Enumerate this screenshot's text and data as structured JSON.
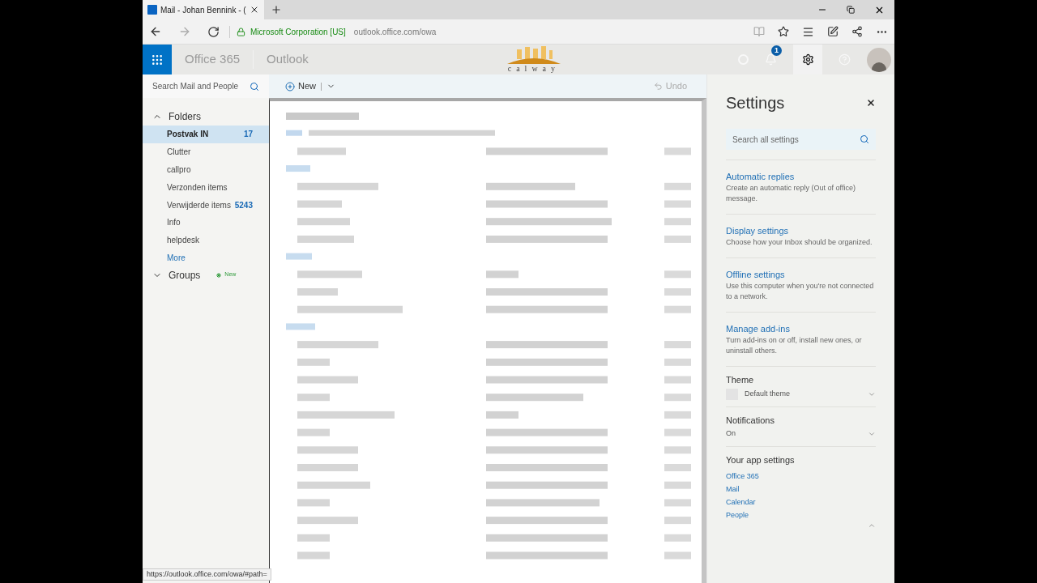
{
  "browser": {
    "tab_title": "Mail - Johan Bennink - (",
    "site_identity": "Microsoft Corporation [US]",
    "url": "outlook.office.com/owa",
    "status_url": "https://outlook.office.com/owa/#path="
  },
  "header": {
    "suite": "Office 365",
    "app": "Outlook",
    "logo": "calway",
    "notification_count": "1"
  },
  "search": {
    "placeholder": "Search Mail and People"
  },
  "folders": {
    "label": "Folders",
    "expanded": true,
    "items": [
      {
        "name": "Postvak IN",
        "count": "17",
        "selected": true
      },
      {
        "name": "Clutter",
        "selected": false
      },
      {
        "name": "callpro",
        "selected": false
      },
      {
        "name": "Verzonden items",
        "selected": false
      },
      {
        "name": "Verwijderde items",
        "count": "5243",
        "selected": false
      },
      {
        "name": "Info",
        "selected": false
      },
      {
        "name": "helpdesk",
        "selected": false
      }
    ],
    "more": "More"
  },
  "groups": {
    "label": "Groups",
    "expanded": false,
    "badge": "New"
  },
  "toolbar": {
    "new": "New",
    "undo": "Undo",
    "undo_disabled": true
  },
  "settings": {
    "title": "Settings",
    "search_placeholder": "Search all settings",
    "sections": [
      {
        "kind": "link",
        "title": "Automatic replies",
        "description": "Create an automatic reply (Out of office) message."
      },
      {
        "kind": "link",
        "title": "Display settings",
        "description": "Choose how your Inbox should be organized."
      },
      {
        "kind": "link",
        "title": "Offline settings",
        "description": "Use this computer when you're not connected to a network."
      },
      {
        "kind": "link",
        "title": "Manage add-ins",
        "description": "Turn add-ins on or off, install new ones, or uninstall others."
      },
      {
        "kind": "dropdown",
        "title": "Theme",
        "value": "Default theme",
        "swatch": true,
        "expanded": false
      },
      {
        "kind": "dropdown",
        "title": "Notifications",
        "value": "On",
        "expanded": false
      },
      {
        "kind": "links",
        "title": "Your app settings",
        "links": [
          "Office 365",
          "Mail",
          "Calendar",
          "People"
        ],
        "expanded": true
      }
    ]
  }
}
